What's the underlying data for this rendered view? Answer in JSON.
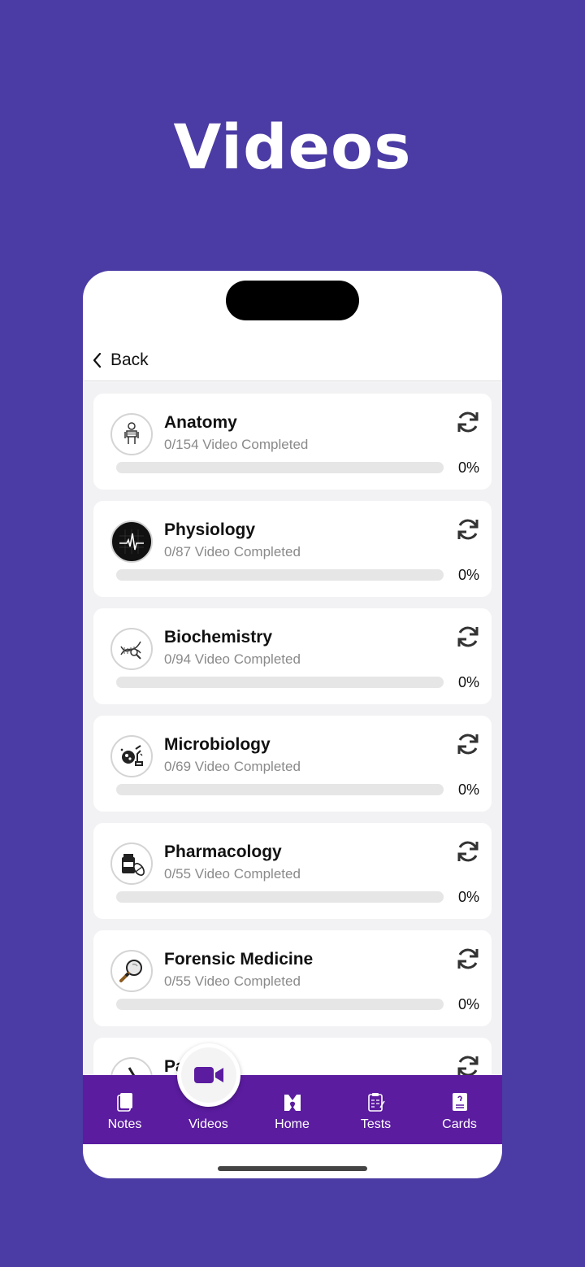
{
  "hero": {
    "title": "Videos"
  },
  "nav": {
    "back_label": "Back"
  },
  "colors": {
    "background": "#4b3ba4",
    "tabbar": "#5b1ca0",
    "accent": "#5a1fa0"
  },
  "subjects": [
    {
      "title": "Anatomy",
      "subtitle": "0/154 Video Completed",
      "progress": 0,
      "percent_label": "0%",
      "icon": "anatomy-skeleton-icon"
    },
    {
      "title": "Physiology",
      "subtitle": "0/87 Video Completed",
      "progress": 0,
      "percent_label": "0%",
      "icon": "ecg-heartbeat-icon"
    },
    {
      "title": "Biochemistry",
      "subtitle": "0/94 Video Completed",
      "progress": 0,
      "percent_label": "0%",
      "icon": "dna-magnifier-icon"
    },
    {
      "title": "Microbiology",
      "subtitle": "0/69 Video Completed",
      "progress": 0,
      "percent_label": "0%",
      "icon": "microscope-bacteria-icon"
    },
    {
      "title": "Pharmacology",
      "subtitle": "0/55 Video Completed",
      "progress": 0,
      "percent_label": "0%",
      "icon": "pill-bottle-icon"
    },
    {
      "title": "Forensic Medicine",
      "subtitle": "0/55 Video Completed",
      "progress": 0,
      "percent_label": "0%",
      "icon": "magnifying-glass-icon"
    },
    {
      "title": "Pa      y",
      "subtitle": "",
      "progress": 0,
      "percent_label": "",
      "icon": "microscope-icon"
    }
  ],
  "tabs": [
    {
      "label": "Notes",
      "icon": "notes-icon"
    },
    {
      "label": "Videos",
      "icon": "video-camera-icon",
      "active": true
    },
    {
      "label": "Home",
      "icon": "home-logo-icon"
    },
    {
      "label": "Tests",
      "icon": "clipboard-test-icon"
    },
    {
      "label": "Cards",
      "icon": "card-icon"
    }
  ]
}
